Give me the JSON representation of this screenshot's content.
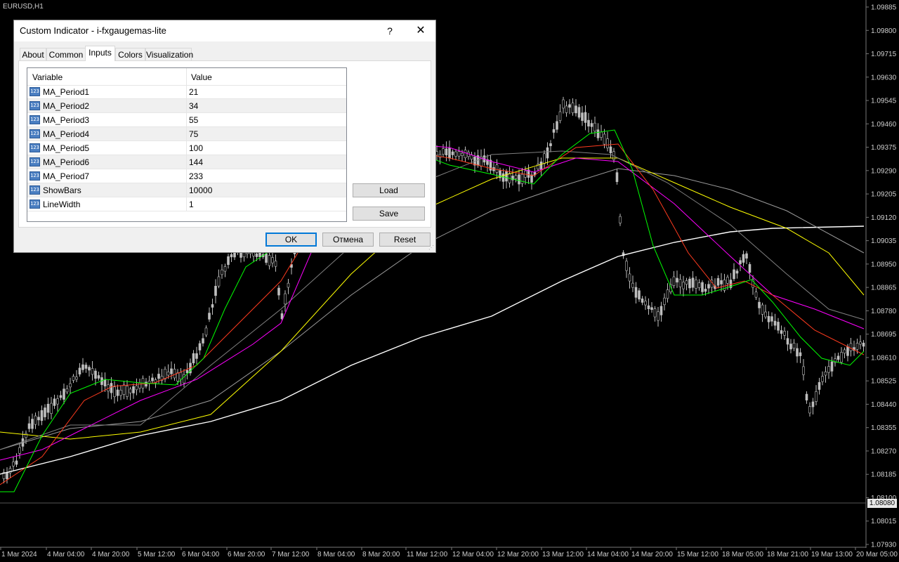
{
  "chart": {
    "symbol_label": "EURUSD,H1",
    "current_price": "1.08080",
    "price_axis": [
      "1.09885",
      "1.09800",
      "1.09715",
      "1.09630",
      "1.09545",
      "1.09460",
      "1.09375",
      "1.09290",
      "1.09205",
      "1.09120",
      "1.09035",
      "1.08950",
      "1.08865",
      "1.08780",
      "1.08695",
      "1.08610",
      "1.08525",
      "1.08440",
      "1.08355",
      "1.08270",
      "1.08185",
      "1.08100",
      "1.08015",
      "1.07930"
    ],
    "time_axis": [
      "1 Mar 2024",
      "4 Mar 04:00",
      "4 Mar 20:00",
      "5 Mar 12:00",
      "6 Mar 04:00",
      "6 Mar 20:00",
      "7 Mar 12:00",
      "8 Mar 04:00",
      "8 Mar 20:00",
      "11 Mar 12:00",
      "12 Mar 04:00",
      "12 Mar 20:00",
      "13 Mar 12:00",
      "14 Mar 04:00",
      "14 Mar 20:00",
      "15 Mar 12:00",
      "18 Mar 05:00",
      "18 Mar 21:00",
      "19 Mar 13:00",
      "20 Mar 05:00"
    ],
    "colors": {
      "background": "#000000",
      "candle": "#bfbfbf",
      "ma1": "#00ff00",
      "ma2": "#ff3b1f",
      "ma3": "#ff00ff",
      "ma4": "#7f7f7f",
      "ma5": "#ffff00",
      "ma6": "#9a9a9a",
      "ma7": "#ffffff"
    }
  },
  "dialog": {
    "title": "Custom Indicator - i-fxgaugemas-lite",
    "help_label": "?",
    "close_label": "✕",
    "tabs": [
      {
        "label": "About",
        "active": false
      },
      {
        "label": "Common",
        "active": false
      },
      {
        "label": "Inputs",
        "active": true
      },
      {
        "label": "Colors",
        "active": false
      },
      {
        "label": "Visualization",
        "active": false
      }
    ],
    "columns": {
      "variable": "Variable",
      "value": "Value"
    },
    "type_icon": "123",
    "inputs": [
      {
        "variable": "MA_Period1",
        "value": "21"
      },
      {
        "variable": "MA_Period2",
        "value": "34"
      },
      {
        "variable": "MA_Period3",
        "value": "55"
      },
      {
        "variable": "MA_Period4",
        "value": "75"
      },
      {
        "variable": "MA_Period5",
        "value": "100"
      },
      {
        "variable": "MA_Period6",
        "value": "144"
      },
      {
        "variable": "MA_Period7",
        "value": "233"
      },
      {
        "variable": "ShowBars",
        "value": "10000"
      },
      {
        "variable": "LineWidth",
        "value": "1"
      }
    ],
    "buttons": {
      "load": "Load",
      "save": "Save",
      "ok": "OK",
      "cancel": "Отмена",
      "reset": "Reset"
    }
  }
}
